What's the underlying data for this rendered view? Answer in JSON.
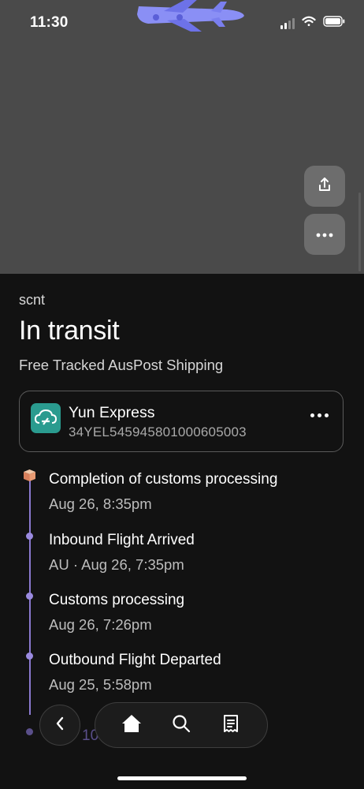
{
  "status_bar": {
    "time": "11:30"
  },
  "order": {
    "seller": "scnt",
    "status": "In transit",
    "shipping_method": "Free Tracked AusPost Shipping"
  },
  "carrier": {
    "name": "Yun Express",
    "tracking_number": "34YEL545945801000605003",
    "logo_color": "#2a9b8f"
  },
  "events": [
    {
      "title": "Completion of customs processing",
      "time": "Aug 26, 8:35pm",
      "icon": "package-icon"
    },
    {
      "title": "Inbound Flight Arrived",
      "time": "AU · Aug 26, 7:35pm",
      "icon": "dot"
    },
    {
      "title": "Customs processing",
      "time": "Aug 26, 7:26pm",
      "icon": "dot"
    },
    {
      "title": "Outbound Flight Departed",
      "time": "Aug 25, 5:58pm",
      "icon": "dot"
    }
  ],
  "partial_event_text": "10",
  "nav": {
    "back_icon": "chevron-left-icon",
    "items": [
      {
        "icon": "home-icon",
        "active": true
      },
      {
        "icon": "search-icon",
        "active": false
      },
      {
        "icon": "receipt-icon",
        "active": false
      }
    ]
  },
  "colors": {
    "header_background": "#4a4a4a",
    "background": "#121212",
    "timeline_accent": "#9a8ae0"
  }
}
